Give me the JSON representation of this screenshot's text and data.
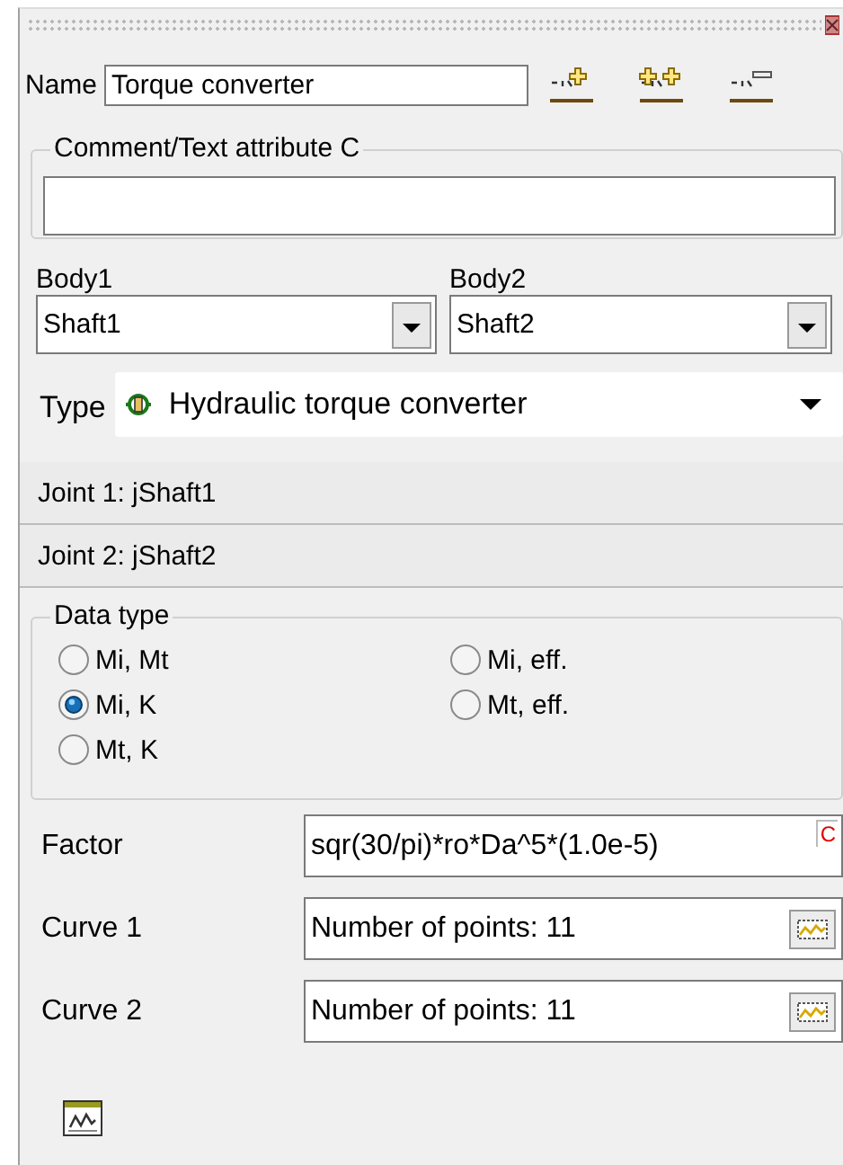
{
  "name_field": {
    "label": "Name",
    "value": "Torque converter"
  },
  "comment": {
    "label": "Comment/Text attribute C"
  },
  "bodies": [
    {
      "label": "Body1",
      "value": "Shaft1"
    },
    {
      "label": "Body2",
      "value": "Shaft2"
    }
  ],
  "type": {
    "label": "Type",
    "value": "Hydraulic torque converter"
  },
  "joints": [
    "Joint 1: jShaft1",
    "Joint 2: jShaft2"
  ],
  "data_type": {
    "label": "Data type",
    "options": [
      {
        "label": "Mi, Mt",
        "selected": false
      },
      {
        "label": "Mi, eff.",
        "selected": false
      },
      {
        "label": "Mi, K",
        "selected": true
      },
      {
        "label": "Mt, eff.",
        "selected": false
      },
      {
        "label": "Mt, K",
        "selected": false
      }
    ]
  },
  "factor": {
    "label": "Factor",
    "value": "sqr(30/pi)*ro*Da^5*(1.0e-5)",
    "badge": "C"
  },
  "curves": [
    {
      "label": "Curve 1",
      "value": "Number of points: 11"
    },
    {
      "label": "Curve 2",
      "value": "Number of points: 11"
    }
  ]
}
